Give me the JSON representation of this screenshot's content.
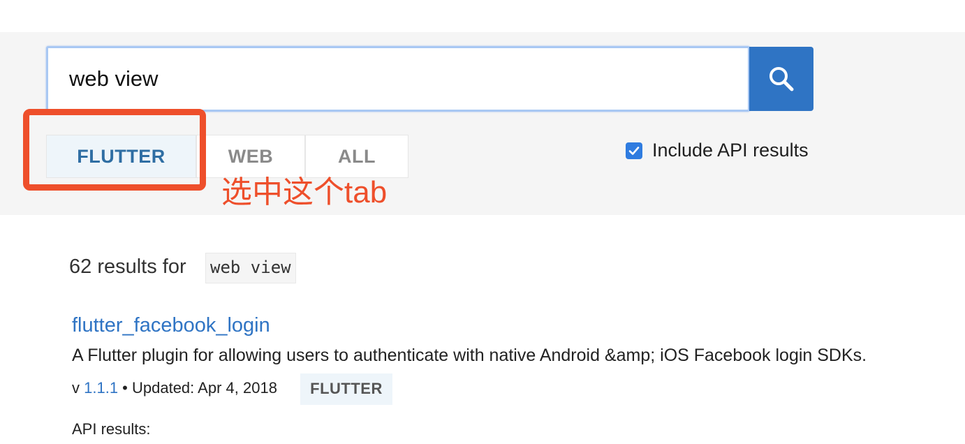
{
  "search": {
    "value": "web view",
    "button_icon": "search-icon"
  },
  "tabs": [
    {
      "label": "FLUTTER",
      "selected": true
    },
    {
      "label": "WEB",
      "selected": false
    },
    {
      "label": "ALL",
      "selected": false
    }
  ],
  "annotation": {
    "text": "选中这个tab",
    "color": "#ee4f2b"
  },
  "include_api": {
    "label": "Include API results",
    "checked": true
  },
  "results": {
    "count_text": "62 results for",
    "query": "web view",
    "items": [
      {
        "title": "flutter_facebook_login",
        "description": "A Flutter plugin for allowing users to authenticate with native Android &amp; iOS Facebook login SDKs.",
        "version_prefix": "v",
        "version": "1.1.1",
        "updated": " • Updated: Apr 4, 2018",
        "badge": "FLUTTER"
      }
    ],
    "api_results_label": "API results:"
  },
  "colors": {
    "primary_blue": "#2f74c4",
    "selected_tab_text": "#2f6ea3",
    "selected_tab_bg": "#eef5fa",
    "banner_bg": "#f5f5f5",
    "annotation_red": "#ee4f2b"
  }
}
